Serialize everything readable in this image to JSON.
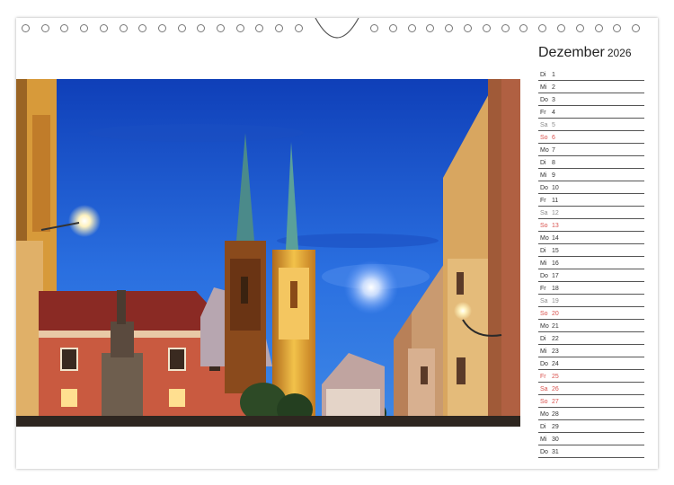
{
  "calendar": {
    "month_title": "Dezember",
    "year": "2026",
    "days": [
      {
        "wd": "Di",
        "d": "1",
        "type": "normal"
      },
      {
        "wd": "Mi",
        "d": "2",
        "type": "normal"
      },
      {
        "wd": "Do",
        "d": "3",
        "type": "normal"
      },
      {
        "wd": "Fr",
        "d": "4",
        "type": "normal"
      },
      {
        "wd": "Sa",
        "d": "5",
        "type": "sat"
      },
      {
        "wd": "So",
        "d": "6",
        "type": "sun"
      },
      {
        "wd": "Mo",
        "d": "7",
        "type": "normal"
      },
      {
        "wd": "Di",
        "d": "8",
        "type": "normal"
      },
      {
        "wd": "Mi",
        "d": "9",
        "type": "normal"
      },
      {
        "wd": "Do",
        "d": "10",
        "type": "normal"
      },
      {
        "wd": "Fr",
        "d": "11",
        "type": "normal"
      },
      {
        "wd": "Sa",
        "d": "12",
        "type": "sat"
      },
      {
        "wd": "So",
        "d": "13",
        "type": "sun"
      },
      {
        "wd": "Mo",
        "d": "14",
        "type": "normal"
      },
      {
        "wd": "Di",
        "d": "15",
        "type": "normal"
      },
      {
        "wd": "Mi",
        "d": "16",
        "type": "normal"
      },
      {
        "wd": "Do",
        "d": "17",
        "type": "normal"
      },
      {
        "wd": "Fr",
        "d": "18",
        "type": "normal"
      },
      {
        "wd": "Sa",
        "d": "19",
        "type": "sat"
      },
      {
        "wd": "So",
        "d": "20",
        "type": "sun"
      },
      {
        "wd": "Mo",
        "d": "21",
        "type": "normal"
      },
      {
        "wd": "Di",
        "d": "22",
        "type": "normal"
      },
      {
        "wd": "Mi",
        "d": "23",
        "type": "normal"
      },
      {
        "wd": "Do",
        "d": "24",
        "type": "normal"
      },
      {
        "wd": "Fr",
        "d": "25",
        "type": "sun"
      },
      {
        "wd": "Sa",
        "d": "26",
        "type": "sun"
      },
      {
        "wd": "So",
        "d": "27",
        "type": "sun"
      },
      {
        "wd": "Mo",
        "d": "28",
        "type": "normal"
      },
      {
        "wd": "Di",
        "d": "29",
        "type": "normal"
      },
      {
        "wd": "Mi",
        "d": "30",
        "type": "normal"
      },
      {
        "wd": "Do",
        "d": "31",
        "type": "normal"
      }
    ]
  },
  "colors": {
    "sky": "#1f5fd0",
    "weekend_sat": "#8c8c8c",
    "holiday_red": "#d9534f",
    "cathedral_gold": "#e6a531"
  }
}
